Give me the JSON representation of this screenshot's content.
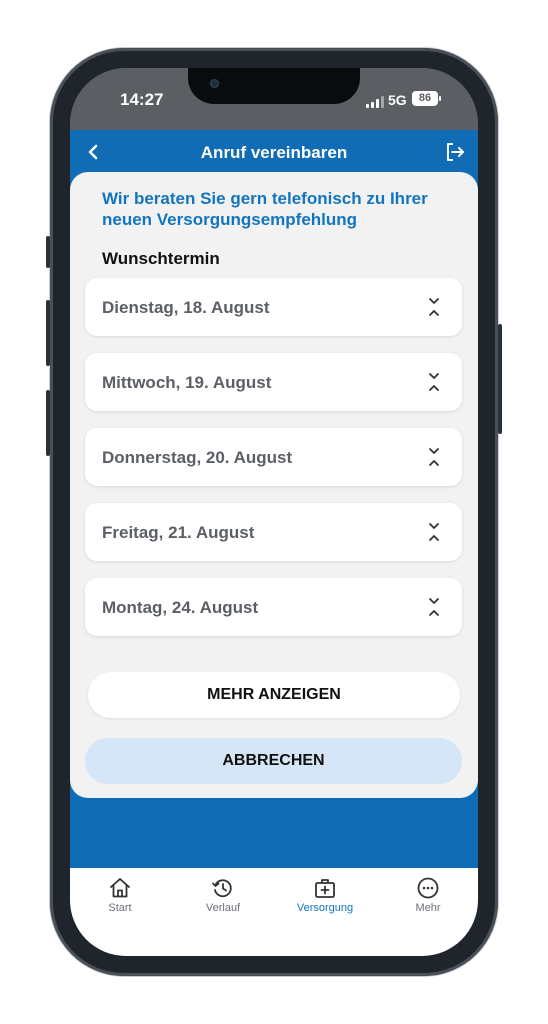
{
  "status_bar": {
    "time": "14:27",
    "network": "5G",
    "battery": "86"
  },
  "header": {
    "title": "Anruf vereinbaren"
  },
  "content": {
    "intro": "Wir beraten Sie gern telefonisch zu Ihrer neuen Versorgungsempfehlung",
    "section_label": "Wunschtermin",
    "dates": [
      {
        "label": "Dienstag, 18. August"
      },
      {
        "label": "Mittwoch, 19. August"
      },
      {
        "label": "Donnerstag, 20. August"
      },
      {
        "label": "Freitag, 21. August"
      },
      {
        "label": "Montag, 24. August"
      }
    ],
    "more_button": "MEHR ANZEIGEN",
    "cancel_button": "ABBRECHEN"
  },
  "tabbar": {
    "tabs": [
      {
        "label": "Start",
        "icon": "home-icon",
        "active": false
      },
      {
        "label": "Verlauf",
        "icon": "history-icon",
        "active": false
      },
      {
        "label": "Versorgung",
        "icon": "medical-bag-icon",
        "active": true
      },
      {
        "label": "Mehr",
        "icon": "more-icon",
        "active": false
      }
    ]
  },
  "colors": {
    "brand_blue": "#0f6cb5",
    "accent_text": "#1375bf",
    "cancel_bg": "#d5e6f6",
    "card_bg": "#f2f2f3"
  }
}
